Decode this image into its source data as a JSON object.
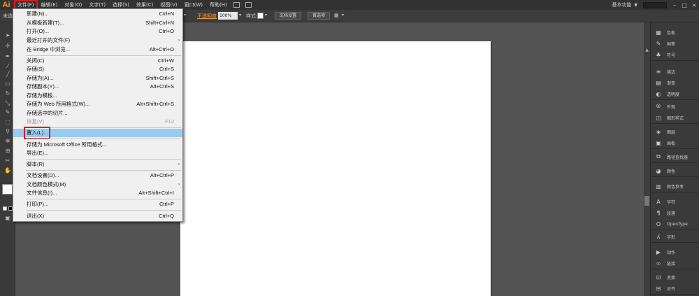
{
  "menubar": {
    "logo": "Ai",
    "items": [
      "文件(F)",
      "编辑(E)",
      "对象(O)",
      "文字(T)",
      "选择(S)",
      "效果(C)",
      "视图(V)",
      "窗口(W)",
      "帮助(H)"
    ],
    "workspace": "基本功能",
    "workspace_dropdown": "▼",
    "minimize": "–",
    "restore": "□",
    "close": "×"
  },
  "controlbar": {
    "left_label": "未选",
    "opacity_label": "不透明度",
    "opacity_value": "100%",
    "style_label": "样式:",
    "doc_setup_btn": "文档设置",
    "prefs_btn": "首选项"
  },
  "file_menu": {
    "items": [
      {
        "label": "新建(N)...",
        "shortcut": "Ctrl+N"
      },
      {
        "label": "从模板新建(T)...",
        "shortcut": "Shift+Ctrl+N"
      },
      {
        "label": "打开(O)...",
        "shortcut": "Ctrl+O"
      },
      {
        "label": "最近打开的文件(F)",
        "shortcut": "",
        "submenu": "›"
      },
      {
        "label": "在 Bridge 中浏览...",
        "shortcut": "Alt+Ctrl+O"
      },
      {
        "label": "关闭(C)",
        "shortcut": "Ctrl+W"
      },
      {
        "label": "存储(S)",
        "shortcut": "Ctrl+S"
      },
      {
        "label": "存储为(A)...",
        "shortcut": "Shift+Ctrl+S"
      },
      {
        "label": "存储副本(Y)...",
        "shortcut": "Alt+Ctrl+S"
      },
      {
        "label": "存储为模板...",
        "shortcut": ""
      },
      {
        "label": "存储为 Web 所用格式(W)...",
        "shortcut": "Alt+Shift+Ctrl+S"
      },
      {
        "label": "存储选中的切片...",
        "shortcut": ""
      },
      {
        "label": "恢复(V)",
        "shortcut": "F12"
      },
      {
        "label": "置入(L)...",
        "shortcut": ""
      },
      {
        "label": "存储为 Microsoft Office 所用格式...",
        "shortcut": ""
      },
      {
        "label": "导出(E)...",
        "shortcut": ""
      },
      {
        "label": "脚本(R)",
        "shortcut": "",
        "submenu": "›"
      },
      {
        "label": "文档设置(D)...",
        "shortcut": "Alt+Ctrl+P"
      },
      {
        "label": "文档颜色模式(M)",
        "shortcut": "",
        "submenu": "›"
      },
      {
        "label": "文件信息(I)...",
        "shortcut": "Alt+Shift+Ctrl+I"
      },
      {
        "label": "打印(P)...",
        "shortcut": "Ctrl+P"
      },
      {
        "label": "退出(X)",
        "shortcut": "Ctrl+Q"
      }
    ]
  },
  "right_panel": {
    "items": [
      "色板",
      "画笔",
      "符号",
      "描边",
      "渐变",
      "透明度",
      "外观",
      "图形样式",
      "图层",
      "画板",
      "路径查找器",
      "颜色",
      "颜色参考",
      "字符",
      "段落",
      "OpenType",
      "字形",
      "动作",
      "链接",
      "变换",
      "对齐"
    ]
  },
  "colors": {
    "highlight": "#99ccf0",
    "annotation_red": "#d42020",
    "logo_orange": "#ff9a00"
  }
}
